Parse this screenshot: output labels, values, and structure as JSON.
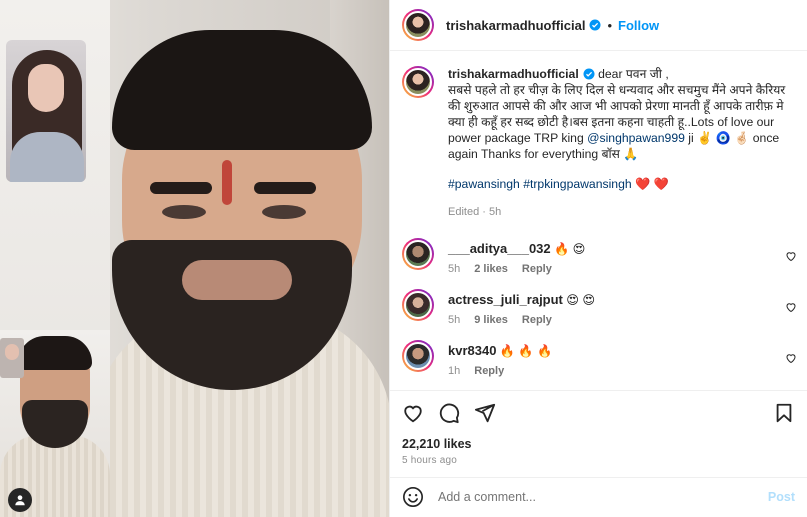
{
  "post": {
    "username": "trishakarmadhuofficial",
    "follow_label": "Follow",
    "more_label": "•••"
  },
  "caption": {
    "username": "trishakarmadhuofficial",
    "text_1": "dear पवन जी ,",
    "text_2": "सबसे पहले तो हर चीज़ के लिए दिल से धन्यवाद और सचमुच मैंने अपने कैरियर की शुरुआत आपसे की और आज भी आपको प्रेरणा मानती हूँ आपके तारीफ़ मे क्या ही कहूँ हर सब्द छोटी है।बस इतना कहना चाहती हू..Lots of love our power package TRP king",
    "mention": "@singhpawan999",
    "text_3": "ji ✌️ 🧿 🤞🏻 once again Thanks for everything बॉस 🙏",
    "tags": "#pawansingh #trpkingpawansingh",
    "tag_hearts": "❤️ ❤️",
    "edited": "Edited · 5h"
  },
  "comments": [
    {
      "username": "___aditya___032",
      "text": "🔥 😍",
      "age": "5h",
      "likes": "2 likes",
      "reply": "Reply"
    },
    {
      "username": "actress_juli_rajput",
      "text": "😍 😍",
      "age": "5h",
      "likes": "9 likes",
      "reply": "Reply"
    },
    {
      "username": "kvr8340",
      "text": "🔥 🔥 🔥",
      "age": "1h",
      "likes": "",
      "reply": "Reply"
    }
  ],
  "stats": {
    "likes": "22,210 likes",
    "time": "5 hours ago"
  },
  "composer": {
    "placeholder": "Add a comment...",
    "post_label": "Post"
  },
  "colors": {
    "accent": "#0095f6",
    "link": "#00376b",
    "muted": "#8e8e8e"
  },
  "icons": [
    "verified-icon",
    "heart-icon",
    "comment-icon",
    "share-icon",
    "bookmark-icon",
    "emoji-icon",
    "user-tag-icon"
  ]
}
